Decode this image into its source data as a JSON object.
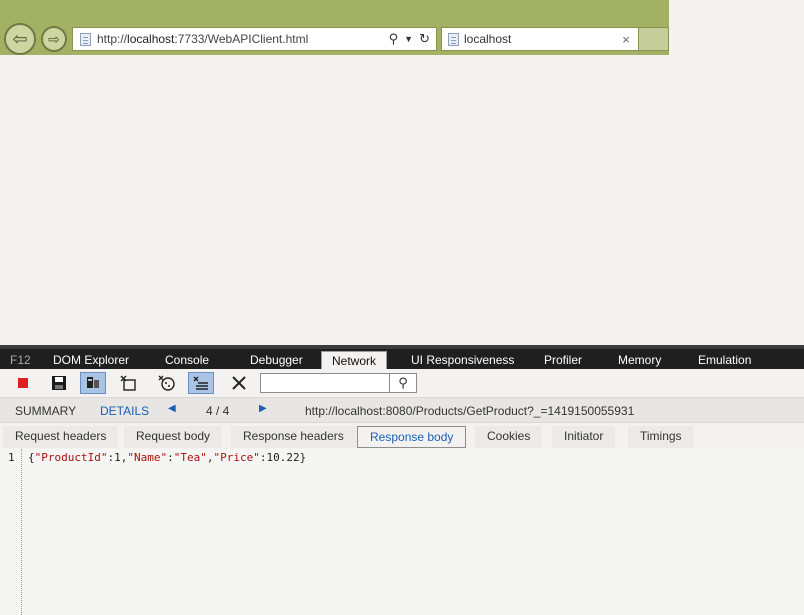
{
  "browser": {
    "url_prefix": "http://",
    "url_host": "localhost",
    "url_rest": ":7733/WebAPIClient.html",
    "tab_title": "localhost",
    "tab_close": "×"
  },
  "devtools": {
    "menu": [
      {
        "label": "F12"
      },
      {
        "label": "DOM Explorer"
      },
      {
        "label": "Console"
      },
      {
        "label": "Debugger"
      },
      {
        "label": "Network",
        "active": true
      },
      {
        "label": "UI Responsiveness"
      },
      {
        "label": "Profiler"
      },
      {
        "label": "Memory"
      },
      {
        "label": "Emulation"
      }
    ],
    "toolbar": {
      "icons": [
        "stop-recording-icon",
        "save-icon",
        "always-refresh-icon",
        "clear-cache-icon",
        "clear-cookies-icon",
        "clear-entries-icon",
        "close-icon",
        "search-icon"
      ],
      "search_value": ""
    },
    "summary": {
      "summary_label": "SUMMARY",
      "details_label": "DETAILS",
      "counter": "4 / 4",
      "request_url": "http://localhost:8080/Products/GetProduct?_=1419150055931"
    },
    "subtabs": [
      {
        "label": "Request headers"
      },
      {
        "label": "Request body"
      },
      {
        "label": "Response headers"
      },
      {
        "label": "Response body",
        "active": true
      },
      {
        "label": "Cookies"
      },
      {
        "label": "Initiator"
      },
      {
        "label": "Timings"
      }
    ],
    "body": {
      "line_number": "1",
      "tokens": [
        "{",
        "\"ProductId\"",
        ":1,",
        "\"Name\"",
        ":",
        "\"Tea\"",
        ",",
        "\"Price\"",
        ":10.22}"
      ]
    }
  },
  "colors": {
    "chrome_accent": "#a3b164",
    "devtools_menu_bg": "#1f1f1f",
    "link_blue": "#1a5fb4",
    "json_key": "#a11"
  }
}
